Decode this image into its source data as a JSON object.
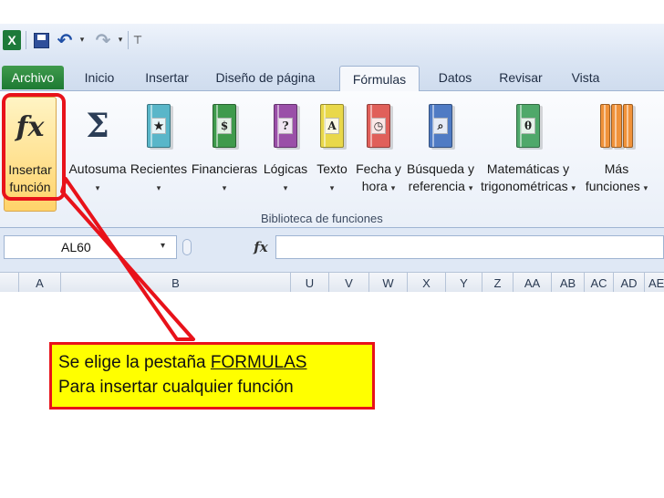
{
  "quick_access": {
    "excel_icon": "excel-logo-icon",
    "excel_letter": "X",
    "save_icon": "save-disk-icon",
    "undo_icon": "undo-arrow-icon",
    "redo_icon": "redo-arrow-icon",
    "dropdown_glyph": "▾",
    "undo_glyph": "↶",
    "redo_glyph": "↷",
    "customize_glyph": "⊤"
  },
  "tabs": [
    {
      "label": "Archivo"
    },
    {
      "label": "Inicio"
    },
    {
      "label": "Insertar"
    },
    {
      "label": "Diseño de página"
    },
    {
      "label": "Fórmulas",
      "active": true
    },
    {
      "label": "Datos"
    },
    {
      "label": "Revisar"
    },
    {
      "label": "Vista"
    }
  ],
  "ribbon": {
    "group_label": "Biblioteca de funciones",
    "arrow": "▾",
    "buttons": [
      {
        "line1": "Insertar",
        "line2": "función",
        "icon": "function-fx-icon",
        "glyph": "fx"
      },
      {
        "line1": "Autosuma",
        "line2": "",
        "icon": "sigma-autosum-icon",
        "glyph": "Σ"
      },
      {
        "line1": "Recientes",
        "line2": "",
        "icon": "recent-book-icon",
        "glyph": "★",
        "color": "#59b6c9"
      },
      {
        "line1": "Financieras",
        "line2": "",
        "icon": "financial-book-icon",
        "glyph": "$",
        "color": "#3f9a4c"
      },
      {
        "line1": "Lógicas",
        "line2": "",
        "icon": "logical-book-icon",
        "glyph": "?",
        "color": "#9a4fa8"
      },
      {
        "line1": "Texto",
        "line2": "",
        "icon": "text-book-icon",
        "glyph": "A",
        "color": "#e9d84a"
      },
      {
        "line1": "Fecha y",
        "line2": "hora",
        "icon": "date-time-book-icon",
        "glyph": "◷",
        "color": "#e0605a"
      },
      {
        "line1": "Búsqueda y",
        "line2": "referencia",
        "icon": "lookup-book-icon",
        "glyph": "⌕",
        "color": "#4f7bc4"
      },
      {
        "line1": "Matemáticas y",
        "line2": "trigonométricas",
        "icon": "math-trig-book-icon",
        "glyph": "θ",
        "color": "#4fa86a"
      },
      {
        "line1": "Más",
        "line2": "funciones",
        "icon": "more-functions-books-icon",
        "glyph": "",
        "color": "#f0923a"
      }
    ]
  },
  "formula_bar": {
    "name_box": "AL60",
    "fx": "fx",
    "dropdown_glyph": "▾",
    "value": ""
  },
  "columns": [
    "A",
    "B",
    "U",
    "V",
    "W",
    "X",
    "Y",
    "Z",
    "AA",
    "AB",
    "AC",
    "AD",
    "AE"
  ],
  "callout": {
    "prefix": "Se elige la pestaña ",
    "emphasis": "FORMULAS",
    "line2": "Para insertar cualquier función"
  },
  "colors": {
    "callout_border": "#e8121a",
    "callout_fill": "#ffff00",
    "file_tab": "#1d7a33"
  }
}
